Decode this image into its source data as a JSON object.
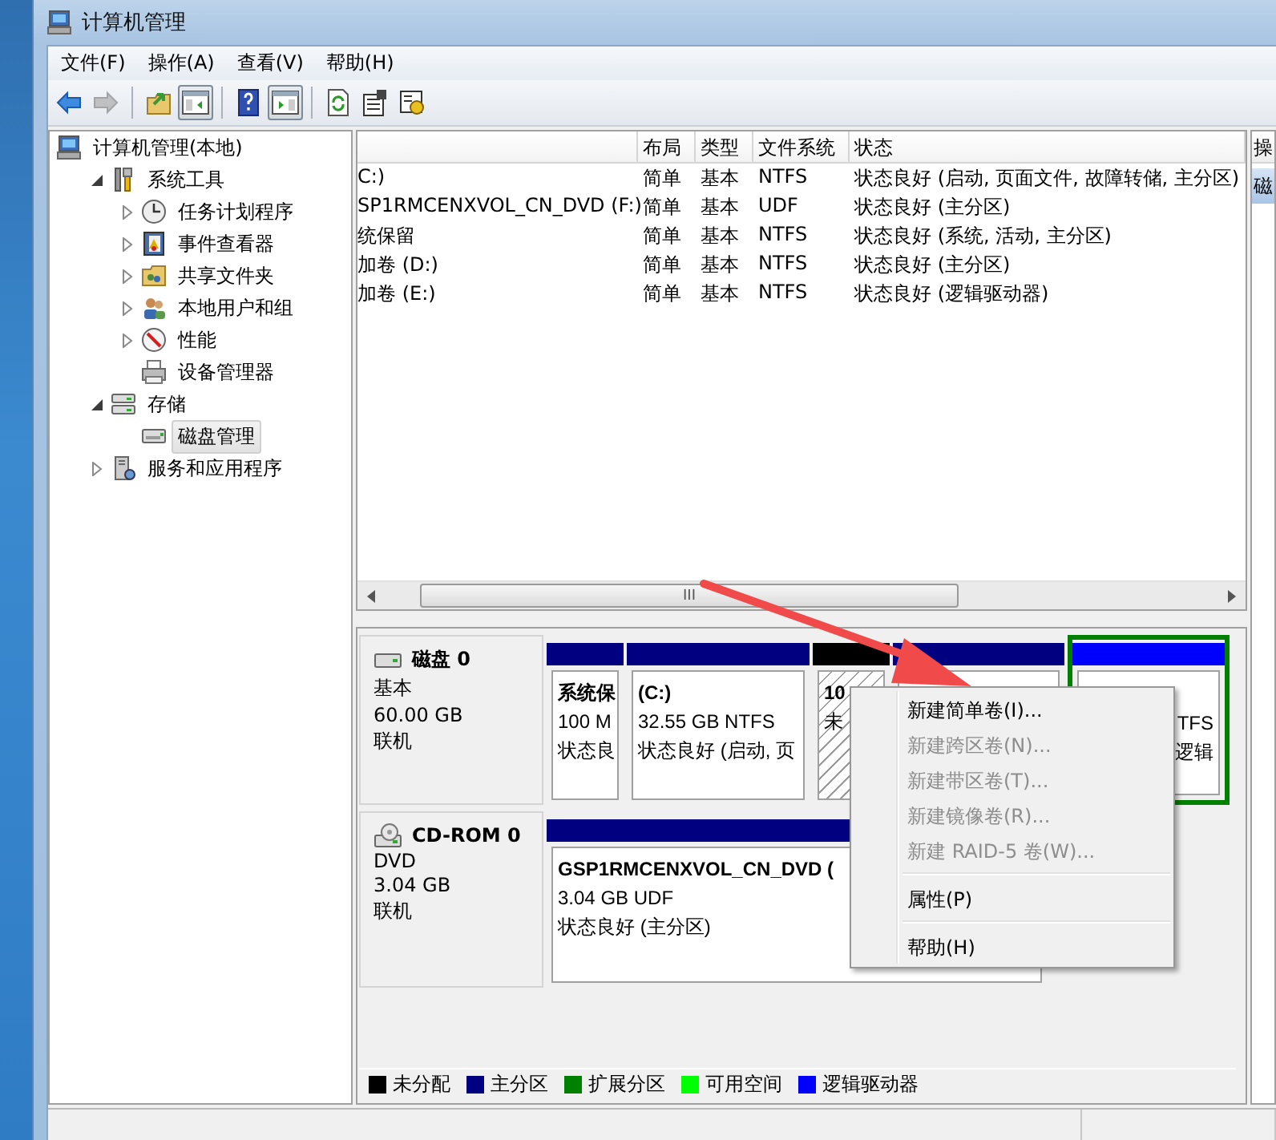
{
  "window": {
    "title": "计算机管理"
  },
  "menu_bar": [
    "文件(F)",
    "操作(A)",
    "查看(V)",
    "帮助(H)"
  ],
  "toolbar": [
    {
      "kind": "back",
      "pressed": false,
      "disabled": false
    },
    {
      "kind": "forward",
      "pressed": false,
      "disabled": true
    },
    {
      "kind": "separator"
    },
    {
      "kind": "up",
      "pressed": false,
      "disabled": false
    },
    {
      "kind": "console_tree",
      "pressed": true,
      "disabled": false
    },
    {
      "kind": "separator"
    },
    {
      "kind": "help",
      "pressed": false,
      "disabled": false
    },
    {
      "kind": "action_pane",
      "pressed": true,
      "disabled": false
    },
    {
      "kind": "separator"
    },
    {
      "kind": "refresh",
      "pressed": false,
      "disabled": false
    },
    {
      "kind": "properties",
      "pressed": false,
      "disabled": false
    },
    {
      "kind": "settings",
      "pressed": false,
      "disabled": false
    }
  ],
  "tree": [
    {
      "label": "计算机管理(本地)",
      "kind": "root",
      "selected": false,
      "children": [
        {
          "label": "系统工具",
          "kind": "branch",
          "expanded": true,
          "selected": false,
          "children": [
            {
              "label": "任务计划程序",
              "kind": "branch",
              "expanded": false,
              "selected": false
            },
            {
              "label": "事件查看器",
              "kind": "branch",
              "expanded": false,
              "selected": false
            },
            {
              "label": "共享文件夹",
              "kind": "branch",
              "expanded": false,
              "selected": false
            },
            {
              "label": "本地用户和组",
              "kind": "branch",
              "expanded": false,
              "selected": false
            },
            {
              "label": "性能",
              "kind": "branch",
              "expanded": false,
              "selected": false
            },
            {
              "label": "设备管理器",
              "kind": "leaf",
              "selected": false
            }
          ]
        },
        {
          "label": "存储",
          "kind": "branch",
          "expanded": true,
          "selected": false,
          "children": [
            {
              "label": "磁盘管理",
              "kind": "leaf",
              "selected": true
            }
          ]
        },
        {
          "label": "服务和应用程序",
          "kind": "branch",
          "expanded": false,
          "selected": false
        }
      ]
    }
  ],
  "table": {
    "columns": [
      "布局",
      "类型",
      "文件系统",
      "状态"
    ],
    "rows": [
      {
        "column_1": "C:)",
        "layout": "简单",
        "type": "基本",
        "file_system": "NTFS",
        "status": "状态良好 (启动, 页面文件, 故障转储, 主分区)"
      },
      {
        "column_1": "SP1RMCENXVOL_CN_DVD (F:)",
        "layout": "简单",
        "type": "基本",
        "file_system": "UDF",
        "status": "状态良好 (主分区)"
      },
      {
        "column_1": "统保留",
        "layout": "简单",
        "type": "基本",
        "file_system": "NTFS",
        "status": "状态良好 (系统, 活动, 主分区)"
      },
      {
        "column_1": "加卷 (D:)",
        "layout": "简单",
        "type": "基本",
        "file_system": "NTFS",
        "status": "状态良好 (主分区)"
      },
      {
        "column_1": "加卷 (E:)",
        "layout": "简单",
        "type": "基本",
        "file_system": "NTFS",
        "status": "状态良好 (逻辑驱动器)"
      }
    ],
    "scrollbar_grip": "III"
  },
  "disks": [
    {
      "kind": "disk",
      "name": "磁盘 0",
      "type": "基本",
      "size": "60.00 GB",
      "status": "联机",
      "partitions": [
        {
          "kind": "primary",
          "covered": false,
          "lines": [
            "系统保",
            "100 M",
            "状态良"
          ]
        },
        {
          "kind": "primary",
          "covered": false,
          "lines": [
            "(C:)",
            "32.55 GB NTFS",
            "状态良好 (启动, 页"
          ]
        },
        {
          "kind": "unallocated",
          "covered": false,
          "lines": [
            "10",
            "未"
          ]
        },
        {
          "kind": "primary"
        },
        {
          "kind": "logical",
          "covered": true,
          "lines": [
            "TFS",
            "逻辑"
          ]
        }
      ]
    },
    {
      "kind": "cdrom",
      "name": "CD-ROM 0",
      "type": "DVD",
      "size": "3.04 GB",
      "status": "联机",
      "partitions": [
        {
          "kind": "primary",
          "covered": false,
          "lines": [
            "GSP1RMCENXVOL_CN_DVD  (",
            "3.04 GB UDF",
            "状态良好 (主分区)"
          ]
        }
      ]
    }
  ],
  "legend": [
    {
      "label": "未分配",
      "color": "#000000"
    },
    {
      "label": "主分区",
      "color": "#000080"
    },
    {
      "label": "扩展分区",
      "color": "#008000"
    },
    {
      "label": "可用空间",
      "color": "#00ff00"
    },
    {
      "label": "逻辑驱动器",
      "color": "#0000ff"
    }
  ],
  "actions": {
    "header": "操",
    "items": [
      {
        "label": "磁",
        "selected": true
      }
    ]
  },
  "context_menu": [
    {
      "kind": "item",
      "label": "新建简单卷(I)...",
      "disabled": false
    },
    {
      "kind": "item",
      "label": "新建跨区卷(N)...",
      "disabled": true
    },
    {
      "kind": "item",
      "label": "新建带区卷(T)...",
      "disabled": true
    },
    {
      "kind": "item",
      "label": "新建镜像卷(R)...",
      "disabled": true
    },
    {
      "kind": "item",
      "label": "新建 RAID-5 卷(W)...",
      "disabled": true
    },
    {
      "kind": "separator"
    },
    {
      "kind": "item",
      "label": "属性(P)",
      "disabled": false
    },
    {
      "kind": "separator"
    },
    {
      "kind": "item",
      "label": "帮助(H)",
      "disabled": false
    }
  ]
}
